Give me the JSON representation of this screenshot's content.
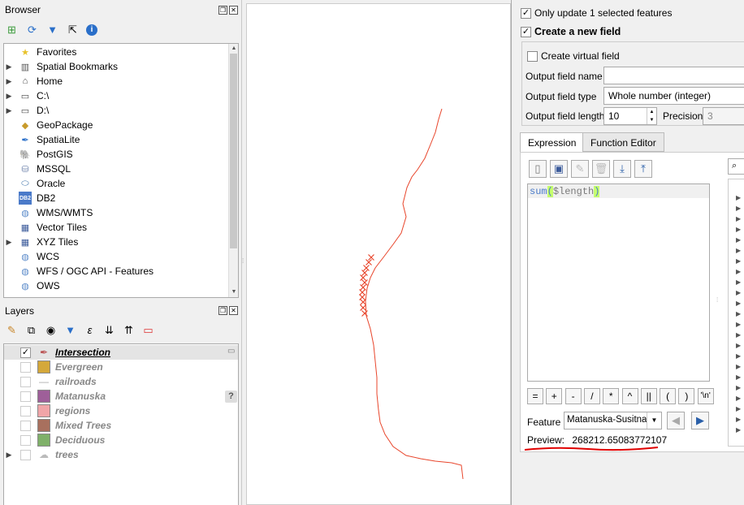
{
  "browser": {
    "title": "Browser",
    "items": [
      {
        "label": "Favorites",
        "icon": "star-icon",
        "expandable": false
      },
      {
        "label": "Spatial Bookmarks",
        "icon": "bookmark-icon",
        "expandable": true
      },
      {
        "label": "Home",
        "icon": "home-icon",
        "expandable": true
      },
      {
        "label": "C:\\",
        "icon": "folder-icon",
        "expandable": true
      },
      {
        "label": "D:\\",
        "icon": "folder-icon",
        "expandable": true
      },
      {
        "label": "GeoPackage",
        "icon": "geopackage-icon",
        "expandable": false
      },
      {
        "label": "SpatiaLite",
        "icon": "spatialite-icon",
        "expandable": false
      },
      {
        "label": "PostGIS",
        "icon": "postgis-icon",
        "expandable": false
      },
      {
        "label": "MSSQL",
        "icon": "mssql-icon",
        "expandable": false
      },
      {
        "label": "Oracle",
        "icon": "oracle-icon",
        "expandable": false
      },
      {
        "label": "DB2",
        "icon": "db2-icon",
        "expandable": false
      },
      {
        "label": "WMS/WMTS",
        "icon": "globe-icon",
        "expandable": false
      },
      {
        "label": "Vector Tiles",
        "icon": "grid-icon",
        "expandable": false
      },
      {
        "label": "XYZ Tiles",
        "icon": "grid-icon",
        "expandable": true
      },
      {
        "label": "WCS",
        "icon": "globe-icon",
        "expandable": false
      },
      {
        "label": "WFS / OGC API - Features",
        "icon": "wfs-icon",
        "expandable": false
      },
      {
        "label": "OWS",
        "icon": "globe-icon",
        "expandable": false
      }
    ]
  },
  "layers": {
    "title": "Layers",
    "items": [
      {
        "label": "Intersection",
        "checked": true,
        "active": true,
        "swatch": "",
        "icon": "line-layer-icon",
        "expandable": false
      },
      {
        "label": "Evergreen",
        "checked": false,
        "active": false,
        "swatch": "#d4a83a",
        "expandable": false
      },
      {
        "label": "railroads",
        "checked": false,
        "active": false,
        "swatch": "",
        "icon": "line-symbol-icon",
        "expandable": false
      },
      {
        "label": "Matanuska",
        "checked": false,
        "active": false,
        "swatch": "#9e5f99",
        "expandable": false
      },
      {
        "label": "regions",
        "checked": false,
        "active": false,
        "swatch": "#f0a5a8",
        "expandable": false
      },
      {
        "label": "Mixed Trees",
        "checked": false,
        "active": false,
        "swatch": "#a8705e",
        "expandable": false
      },
      {
        "label": "Deciduous",
        "checked": false,
        "active": false,
        "swatch": "#7fb069",
        "expandable": false
      },
      {
        "label": "trees",
        "checked": false,
        "active": false,
        "swatch": "",
        "icon": "cloud-symbol-icon",
        "expandable": true
      }
    ]
  },
  "calc": {
    "only_update_label": "Only update 1 selected features",
    "create_field_label": "Create a new field",
    "virtual_label": "Create virtual field",
    "output_name_label": "Output field name",
    "output_name_value": "",
    "output_type_label": "Output field type",
    "output_type_value": "Whole number (integer)",
    "output_length_label": "Output field length",
    "output_length_value": "10",
    "precision_label": "Precision",
    "precision_value": "3",
    "tab_expression": "Expression",
    "tab_function_editor": "Function Editor",
    "expr_func": "sum",
    "expr_open": "(",
    "expr_arg": "$length",
    "expr_close": ")",
    "operators": [
      "=",
      "+",
      "-",
      "/",
      "*",
      "^",
      "||",
      "(",
      ")",
      "'\\n'"
    ],
    "feature_label": "Feature",
    "feature_value": "Matanuska-Susitna",
    "preview_label": "Preview:",
    "preview_value": "268212.65083772107"
  },
  "colors": {
    "map_line": "#e8452b",
    "highlight": "#c6ff6e",
    "underline": "#e00000"
  }
}
